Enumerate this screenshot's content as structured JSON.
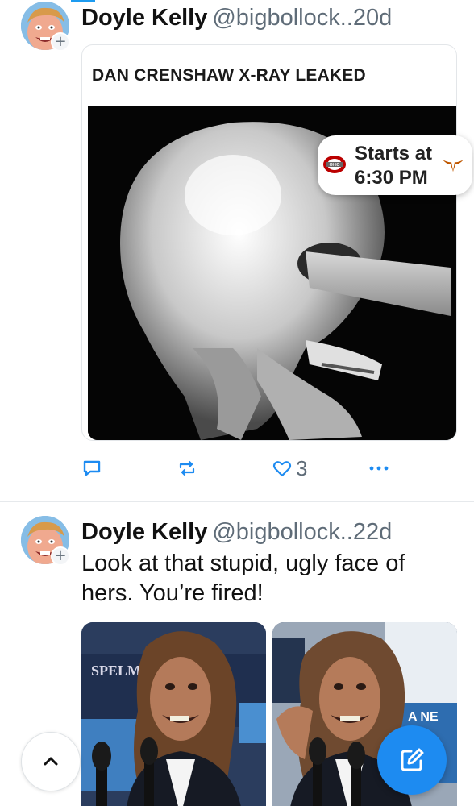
{
  "feed": {
    "posts": [
      {
        "author_name": "Doyle Kelly",
        "handle": "@bigbollock..",
        "time": "20d",
        "embed": {
          "title": "DAN CRENSHAW X-RAY LEAKED",
          "image": "skull-xray-image"
        },
        "actions": {
          "reply_icon": "reply-icon",
          "repost_icon": "repost-icon",
          "like_icon": "heart-icon",
          "like_count": "3",
          "more_icon": "more-icon"
        }
      },
      {
        "author_name": "Doyle Kelly",
        "handle": "@bigbollock..",
        "time": "22d",
        "text": "Look at that stupid, ugly face of hers. You’re fired!",
        "images": [
          "face-photo-left",
          "face-photo-right"
        ]
      }
    ]
  },
  "score_overlay": {
    "line1": "Starts at",
    "line2": "6:30 PM",
    "home_logo": "ohio-state-logo",
    "away_logo": "longhorn-logo"
  },
  "fab": {
    "scroll_top_icon": "chevron-up-icon",
    "compose_icon": "compose-icon"
  },
  "colors": {
    "accent": "#1d8bf1",
    "text_secondary": "#5f6c78",
    "divider": "#e6e9ec"
  }
}
